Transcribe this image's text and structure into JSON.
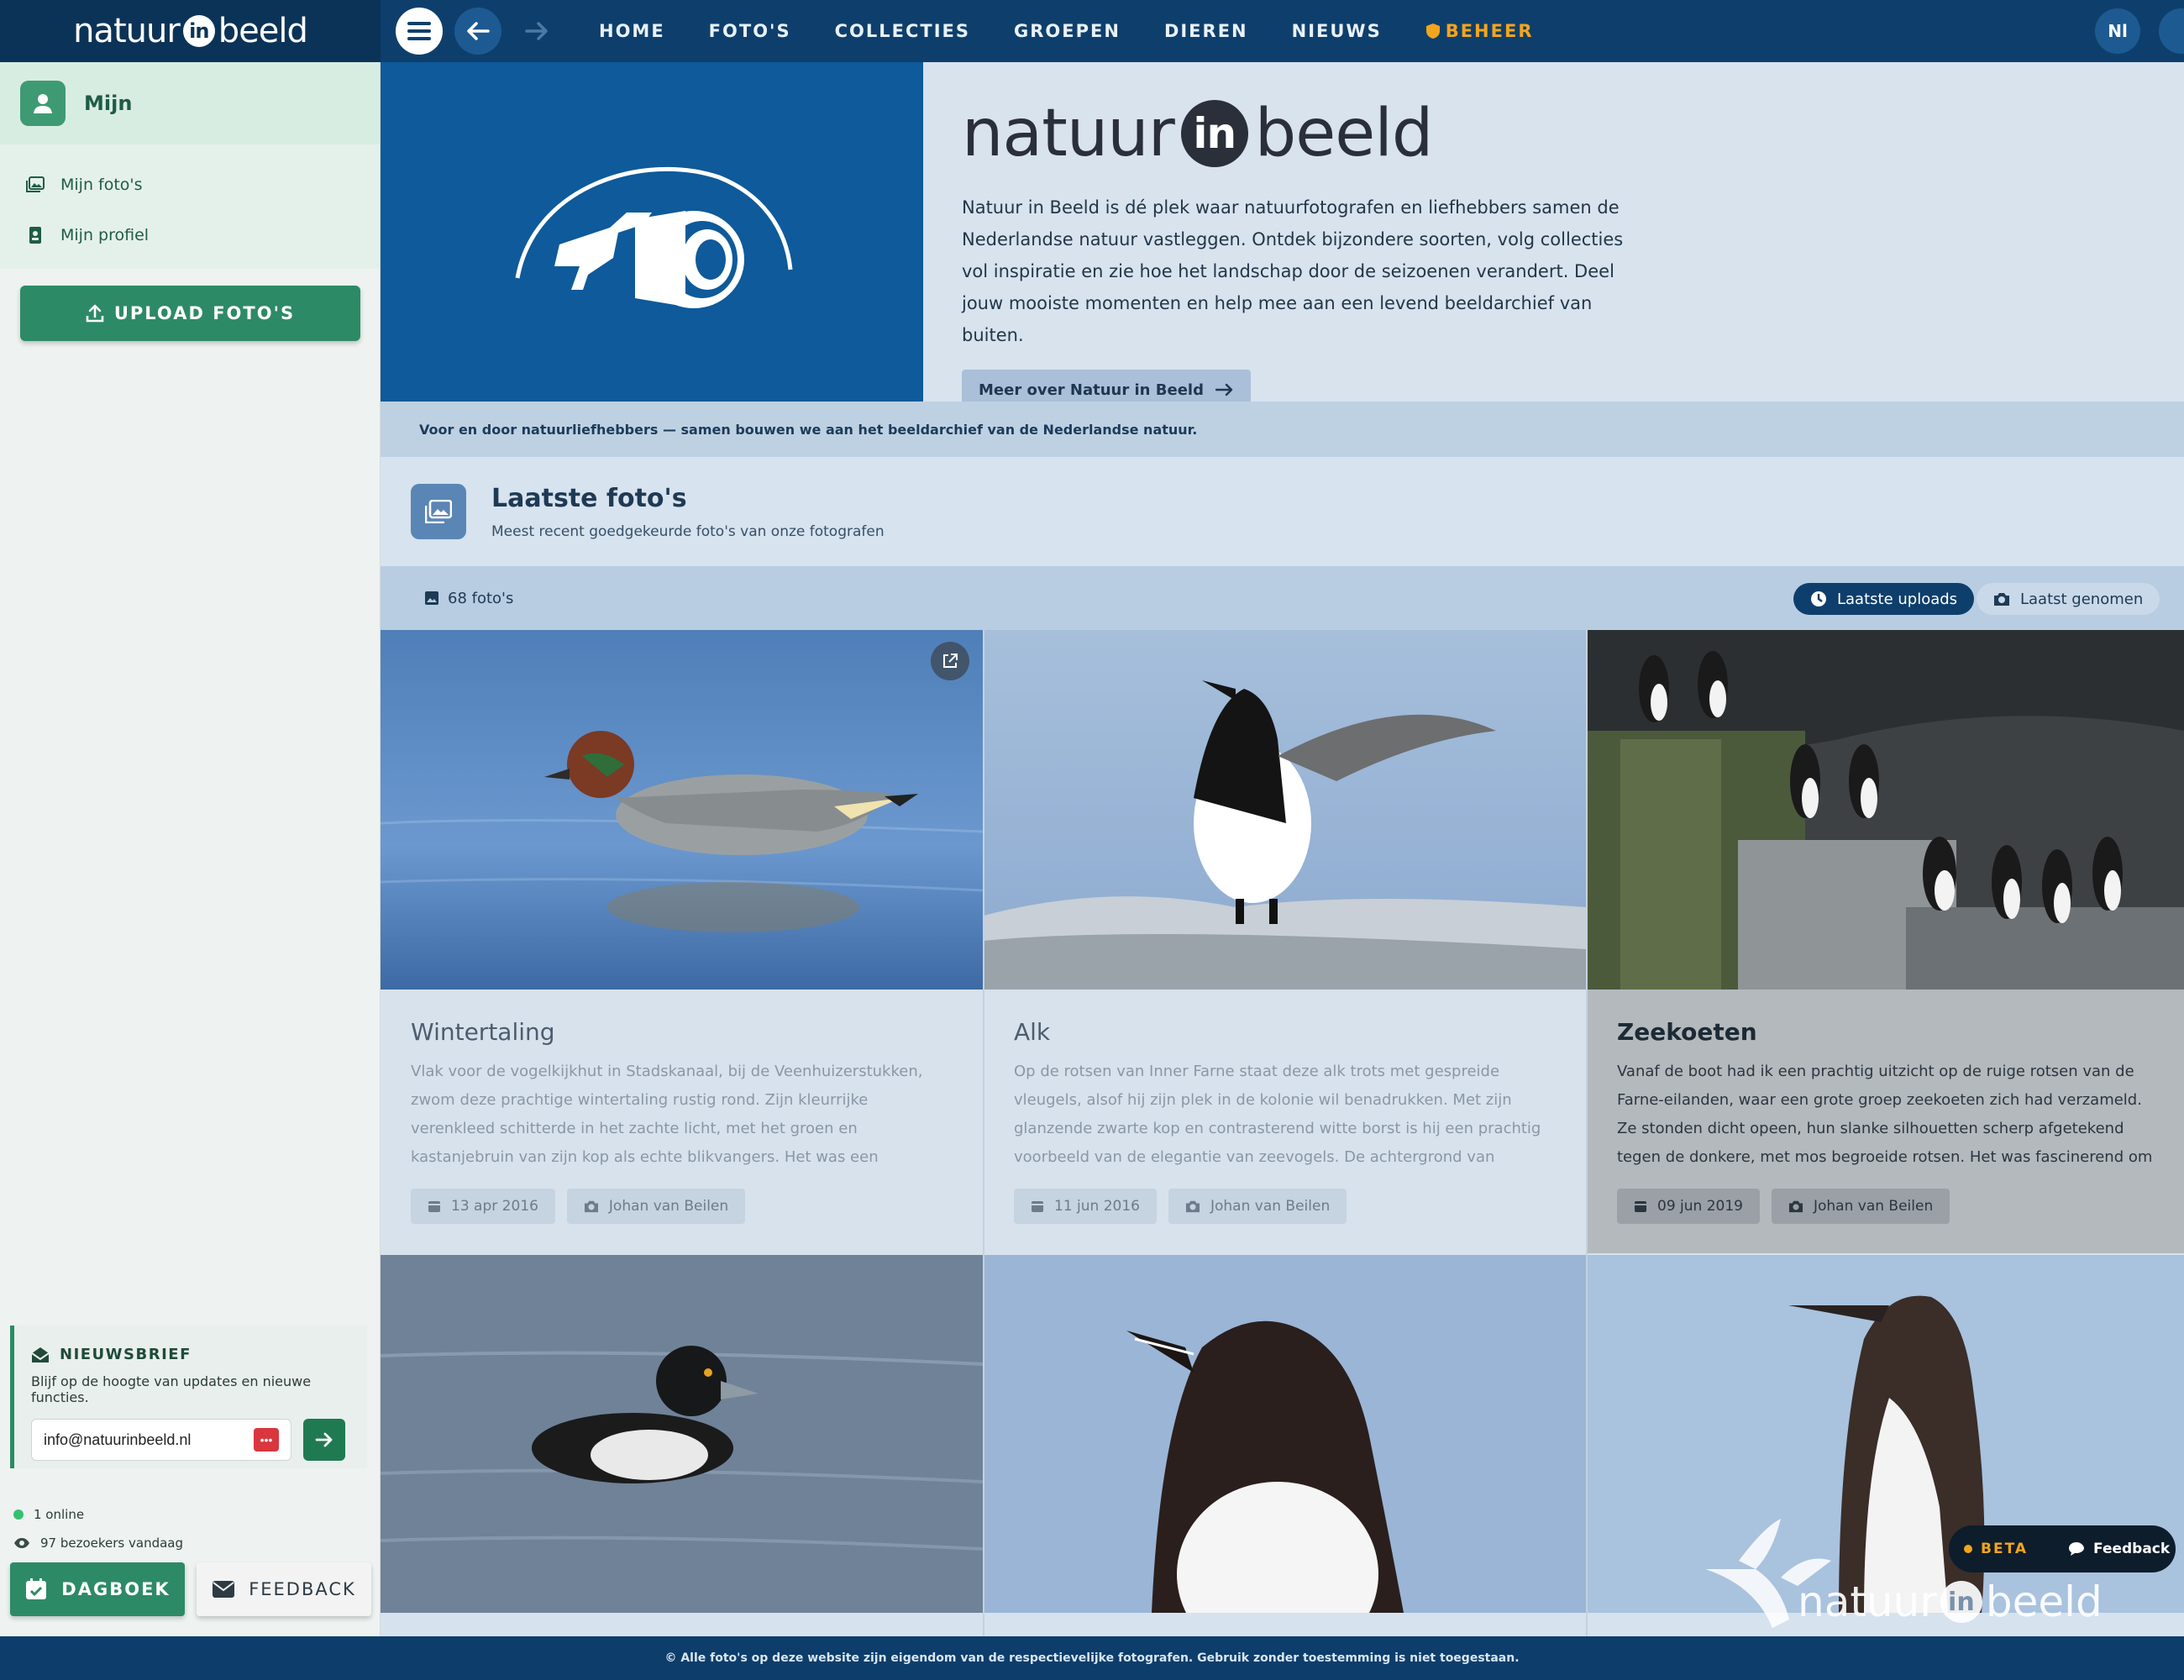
{
  "brand": {
    "pre": "natuur",
    "in": "in",
    "post": "beeld"
  },
  "nav": {
    "links": [
      "HOME",
      "FOTO'S",
      "COLLECTIES",
      "GROEPEN",
      "DIEREN",
      "NIEUWS"
    ],
    "admin": "BEHEER",
    "lang": "Nl"
  },
  "sidebar": {
    "title": "Mijn",
    "items": [
      "Mijn foto's",
      "Mijn profiel"
    ],
    "upload": "UPLOAD FOTO'S",
    "newsletter": {
      "title": "NIEUWSBRIEF",
      "text": "Blijf op de hoogte van updates en nieuwe functies.",
      "email": "info@natuurinbeeld.nl"
    },
    "stats": {
      "online": "1 online",
      "visitors": "97 bezoekers vandaag"
    },
    "dagboek": "DAGBOEK",
    "feedback": "FEEDBACK"
  },
  "hero": {
    "logo_pre": "natuur",
    "logo_in": "in",
    "logo_post": "beeld",
    "text": "Natuur in Beeld is dé plek waar natuurfotografen en liefhebbers samen de Nederlandse natuur vastleggen. Ontdek bijzondere soorten, volg collecties vol inspiratie en zie hoe het landschap door de seizoenen verandert. Deel jouw mooiste momenten en help mee aan een levend beeldarchief van buiten.",
    "cta": "Meer over Natuur in Beeld"
  },
  "tagline": "Voor en door natuurliefhebbers — samen bouwen we aan het beeldarchief van de Nederlandse natuur.",
  "section": {
    "title": "Laatste foto's",
    "subtitle": "Meest recent goedgekeurde foto's van onze fotografen",
    "count": "68 foto's",
    "sort_active": "Laatste uploads",
    "sort_other": "Laatst genomen"
  },
  "cards": [
    {
      "title": "Wintertaling",
      "desc": "Vlak voor de vogelkijkhut in Stadskanaal, bij de Veenhuizerstukken, zwom deze prachtige wintertaling rustig rond. Zijn kleurrijke verenkleed schitterde in het zachte licht, met het groen en kastanjebruin van zijn kop als echte blikvangers. Het was een bijzonder moment om hem van zo…",
      "date": "13 apr 2016",
      "author": "Johan van Beilen"
    },
    {
      "title": "Alk",
      "desc": "Op de rotsen van Inner Farne staat deze alk trots met gespreide vleugels, alsof hij zijn plek in de kolonie wil benadrukken. Met zijn glanzende zwarte kop en contrasterend witte borst is hij een prachtig voorbeeld van de elegantie van zeevogels. De achtergrond van zachtblauw water maakt h…",
      "date": "11 jun 2016",
      "author": "Johan van Beilen"
    },
    {
      "title": "Zeekoeten",
      "desc": "Vanaf de boot had ik een prachtig uitzicht op de ruige rotsen van de Farne-eilanden, waar een grote groep zeekoeten zich had verzameld. Ze stonden dicht opeen, hun slanke silhouetten scherp afgetekend tegen de donkere, met mos begroeide rotsen. Het was fascinerend om te zien hoe deze…",
      "date": "09 jun 2019",
      "author": "Johan van Beilen"
    }
  ],
  "floating": {
    "beta": "BETA",
    "feedback": "Feedback",
    "watermark_pre": "natuur",
    "watermark_in": "in",
    "watermark_post": "beeld"
  },
  "footer": "© Alle foto's op deze website zijn eigendom van de respectievelijke fotografen. Gebruik zonder toestemming is niet toegestaan."
}
